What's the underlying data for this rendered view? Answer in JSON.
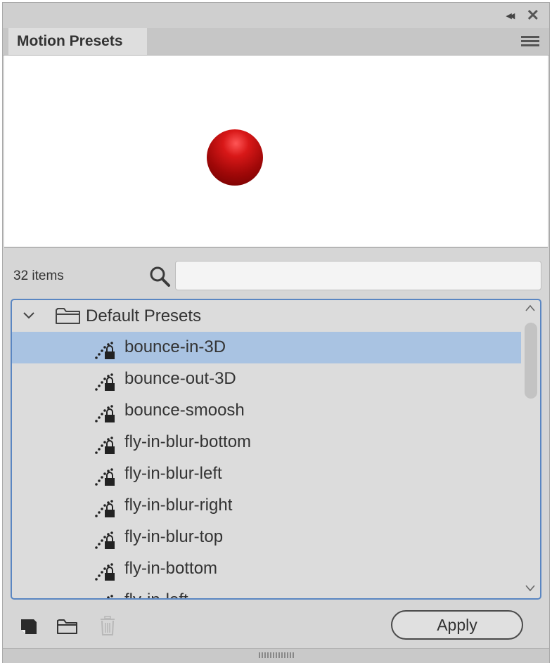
{
  "window": {
    "collapse_glyph": "◂◂",
    "close_glyph": "✕"
  },
  "tab": {
    "title": "Motion Presets",
    "menu_icon": "hamburger-menu-icon"
  },
  "preview": {
    "object": "red-ball",
    "color": "#c81010"
  },
  "search": {
    "count_label": "32 items",
    "value": "",
    "placeholder": ""
  },
  "tree": {
    "folder": {
      "label": "Default Presets",
      "expanded": true
    },
    "items": [
      {
        "label": "bounce-in-3D",
        "selected": true
      },
      {
        "label": "bounce-out-3D",
        "selected": false
      },
      {
        "label": "bounce-smoosh",
        "selected": false
      },
      {
        "label": "fly-in-blur-bottom",
        "selected": false
      },
      {
        "label": "fly-in-blur-left",
        "selected": false
      },
      {
        "label": "fly-in-blur-right",
        "selected": false
      },
      {
        "label": "fly-in-blur-top",
        "selected": false
      },
      {
        "label": "fly-in-bottom",
        "selected": false
      },
      {
        "label": "fly-in-left",
        "selected": false
      }
    ],
    "selection_color": "#a9c3e2",
    "border_color": "#5a86c2"
  },
  "toolbar": {
    "apply_label": "Apply"
  }
}
